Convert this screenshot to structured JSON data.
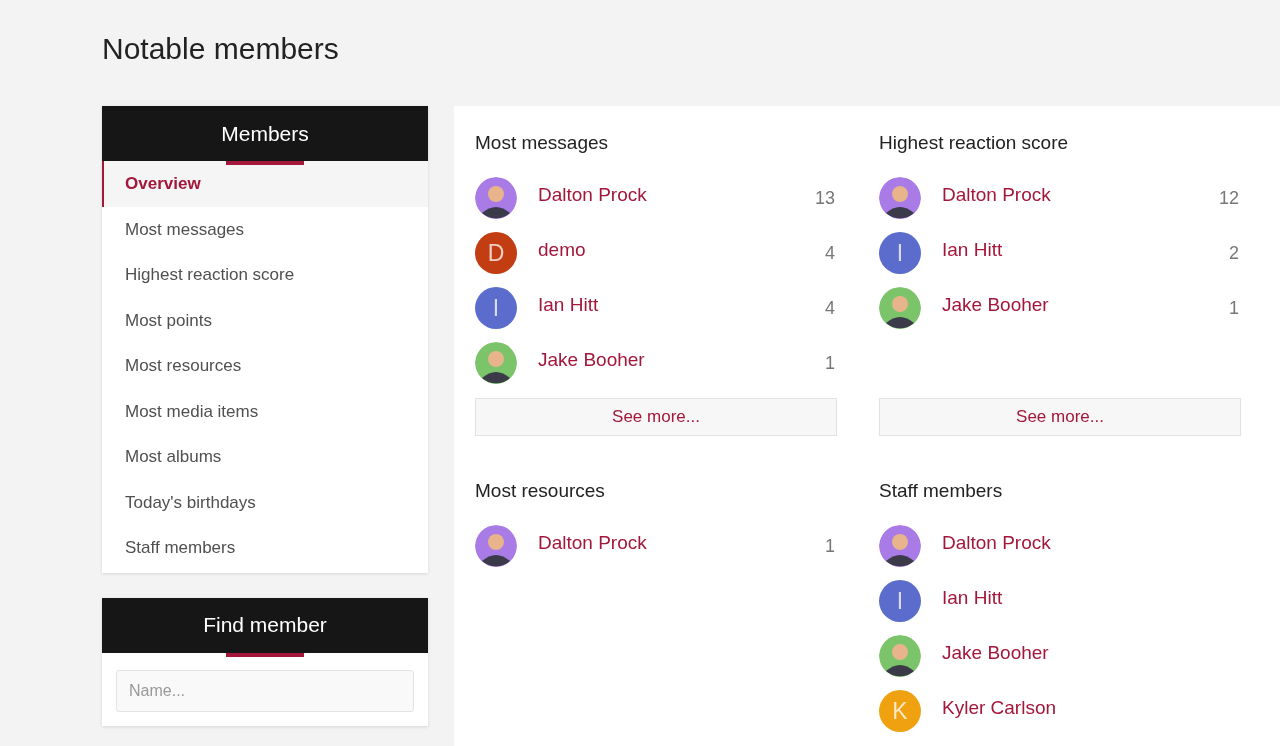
{
  "page_title": "Notable members",
  "sidebar": {
    "title": "Members",
    "items": [
      {
        "label": "Overview",
        "selected": true
      },
      {
        "label": "Most messages",
        "selected": false
      },
      {
        "label": "Highest reaction score",
        "selected": false
      },
      {
        "label": "Most points",
        "selected": false
      },
      {
        "label": "Most resources",
        "selected": false
      },
      {
        "label": "Most media items",
        "selected": false
      },
      {
        "label": "Most albums",
        "selected": false
      },
      {
        "label": "Today's birthdays",
        "selected": false
      },
      {
        "label": "Staff members",
        "selected": false
      }
    ]
  },
  "find_member": {
    "title": "Find member",
    "placeholder": "Name..."
  },
  "sections": [
    {
      "title": "Most messages",
      "see_more": "See more...",
      "members": [
        {
          "name": "Dalton Prock",
          "count": "13"
        },
        {
          "name": "demo",
          "count": "4",
          "avatar": {
            "kind": "letter",
            "letter": "D",
            "color": "#c23d12"
          }
        },
        {
          "name": "Ian Hitt",
          "count": "4",
          "avatar": {
            "kind": "letter",
            "letter": "I",
            "color": "#5c6ccc"
          }
        },
        {
          "name": "Jake Booher",
          "count": "1"
        }
      ]
    },
    {
      "title": "Highest reaction score",
      "see_more": "See more...",
      "members": [
        {
          "name": "Dalton Prock",
          "count": "12"
        },
        {
          "name": "Ian Hitt",
          "count": "2",
          "avatar": {
            "kind": "letter",
            "letter": "I",
            "color": "#5c6ccc"
          }
        },
        {
          "name": "Jake Booher",
          "count": "1"
        }
      ]
    },
    {
      "title": "Most resources",
      "members": [
        {
          "name": "Dalton Prock",
          "count": "1"
        }
      ]
    },
    {
      "title": "Staff members",
      "members": [
        {
          "name": "Dalton Prock"
        },
        {
          "name": "Ian Hitt",
          "avatar": {
            "kind": "letter",
            "letter": "I",
            "color": "#5c6ccc"
          }
        },
        {
          "name": "Jake Booher"
        },
        {
          "name": "Kyler Carlson",
          "avatar": {
            "kind": "letter",
            "letter": "K",
            "color": "#f0a10f"
          }
        }
      ]
    }
  ]
}
